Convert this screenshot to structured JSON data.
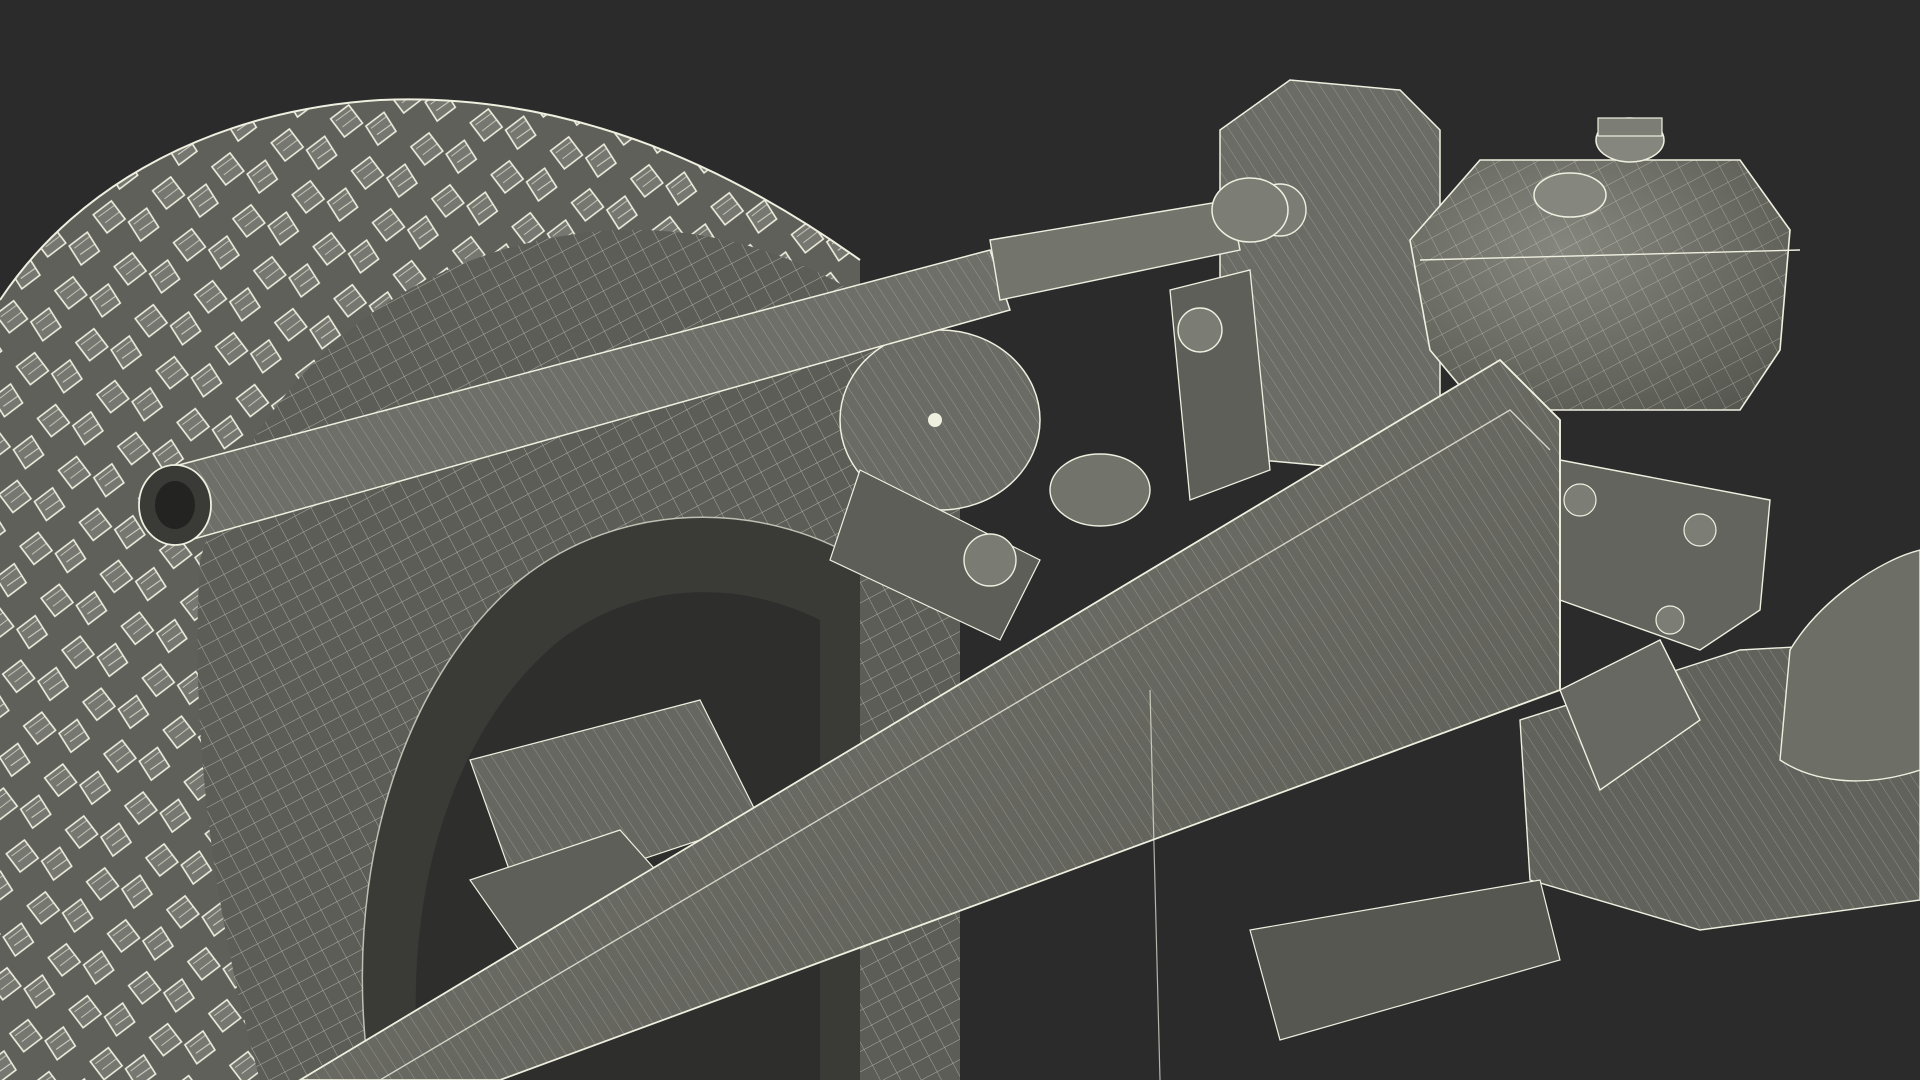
{
  "scene": {
    "subject": "truck-suspension-wireframe-render",
    "colors": {
      "background": "#2b2b2c",
      "shaded_surface": "#696a62",
      "surface_light": "#7d7e75",
      "surface_dark": "#4a4b45",
      "wire_edge": "#efefe0",
      "shadow": "#1d1d1c"
    },
    "components": [
      "tire",
      "wheel-rim",
      "frame-rail",
      "anti-roll-bar",
      "shock-absorber",
      "air-tank",
      "leaf-spring-bracket",
      "cross-member",
      "air-spring"
    ]
  }
}
